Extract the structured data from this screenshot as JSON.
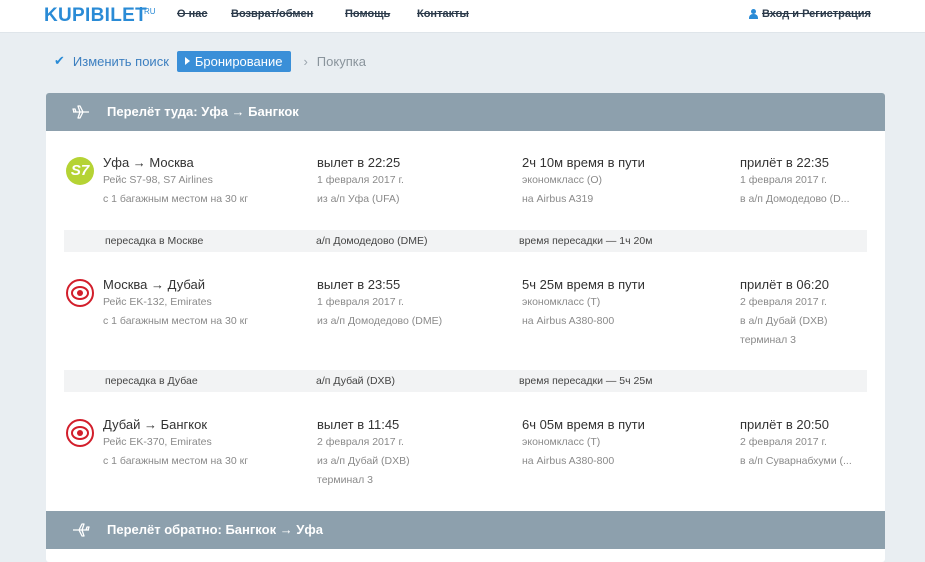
{
  "header": {
    "logo": "KUPIBILET",
    "logo_suffix": "RU",
    "nav": [
      "О нас",
      "Возврат/обмен",
      "Помощь",
      "Контакты"
    ],
    "login": "Вход и Регистрация"
  },
  "steps": {
    "done": "Изменить поиск",
    "active": "Бронирование",
    "next": "Покупка"
  },
  "outbound": {
    "title": "Перелёт туда: Уфа → Бангкок",
    "segments": [
      {
        "airline": "S7 Airlines",
        "logo_text": "S7",
        "route": "Уфа → Москва",
        "flight": "Рейс S7-98, S7 Airlines",
        "baggage": "с 1 багажным местом на 30 кг",
        "depart": "вылет в 22:25",
        "depart_date": "1 февраля 2017 г.",
        "depart_airport": "из а/п Уфа (UFA)",
        "depart_terminal": "",
        "duration": "2ч 10м время в пути",
        "class": "экономкласс (O)",
        "aircraft": "на Airbus A319",
        "arrive": "прилёт в 22:35",
        "arrive_date": "1 февраля 2017 г.",
        "arrive_airport": "в а/п Домодедово (D...",
        "arrive_terminal": ""
      },
      {
        "airline": "Emirates",
        "route": "Москва → Дубай",
        "flight": "Рейс EK-132, Emirates",
        "baggage": "с 1 багажным местом на 30 кг",
        "depart": "вылет в 23:55",
        "depart_date": "1 февраля 2017 г.",
        "depart_airport": "из а/п Домодедово (DME)",
        "depart_terminal": "",
        "duration": "5ч 25м время в пути",
        "class": "экономкласс (T)",
        "aircraft": "на Airbus A380-800",
        "arrive": "прилёт в 06:20",
        "arrive_date": "2 февраля 2017 г.",
        "arrive_airport": "в а/п Дубай (DXB)",
        "arrive_terminal": "терминал 3"
      },
      {
        "airline": "Emirates",
        "route": "Дубай → Бангкок",
        "flight": "Рейс EK-370, Emirates",
        "baggage": "с 1 багажным местом на 30 кг",
        "depart": "вылет в 11:45",
        "depart_date": "2 февраля 2017 г.",
        "depart_airport": "из а/п Дубай (DXB)",
        "depart_terminal": "терминал 3",
        "duration": "6ч 05м время в пути",
        "class": "экономкласс (T)",
        "aircraft": "на Airbus A380-800",
        "arrive": "прилёт в 20:50",
        "arrive_date": "2 февраля 2017 г.",
        "arrive_airport": "в а/п Суварнабхуми (...",
        "arrive_terminal": ""
      }
    ],
    "transfers": [
      {
        "city": "пересадка в Москве",
        "airport": "а/п Домодедово (DME)",
        "time": "время пересадки — 1ч 20м"
      },
      {
        "city": "пересадка в Дубае",
        "airport": "а/п Дубай (DXB)",
        "time": "время пересадки — 5ч 25м"
      }
    ]
  },
  "return": {
    "title": "Перелёт обратно: Бангкок → Уфа"
  },
  "colors": {
    "brand": "#2a8bd6",
    "section_header": "#8da0ad",
    "s7": "#b5d334",
    "emirates": "#d21e2b"
  }
}
